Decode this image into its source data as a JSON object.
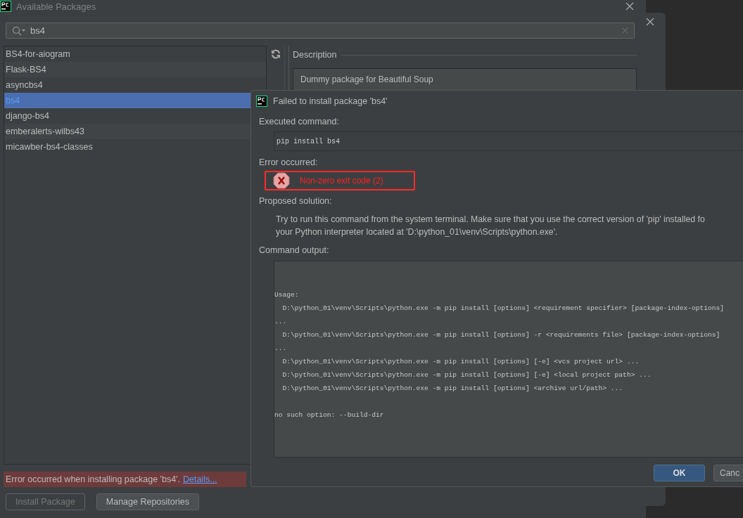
{
  "main_dialog": {
    "title": "Available Packages",
    "search": {
      "value": "bs4"
    },
    "packages": [
      {
        "name": "BS4-for-aiogram",
        "selected": false
      },
      {
        "name": "Flask-BS4",
        "selected": false
      },
      {
        "name": "asyncbs4",
        "selected": false
      },
      {
        "name": "bs4",
        "selected": true
      },
      {
        "name": "django-bs4",
        "selected": false
      },
      {
        "name": "emberalerts-wilbs43",
        "selected": false
      },
      {
        "name": "micawber-bs4-classes",
        "selected": false
      }
    ],
    "description_heading": "Description",
    "description": "Dummy package for Beautiful Soup",
    "error_banner": {
      "text": "Error occurred when installing package 'bs4'.",
      "link": "Details..."
    },
    "buttons": [
      {
        "label": "Install Package",
        "disabled": true
      },
      {
        "label": "Manage Repositories",
        "disabled": false
      }
    ]
  },
  "error_dialog": {
    "title": "Failed to install package 'bs4'",
    "executed_label": "Executed command:",
    "command": "pip install bs4",
    "error_label": "Error occurred:",
    "error_message": "Non-zero exit code (2)",
    "solution_label": "Proposed solution:",
    "solution_lines": [
      "Try to run this command from the system terminal. Make sure that you use the correct version of 'pip' installed fo",
      "your Python interpreter located at 'D:\\python_01\\venv\\Scripts\\python.exe'."
    ],
    "output_label": "Command output:",
    "output_lines": [
      {
        "text": "Usage:"
      },
      {
        "text": "  D:\\python_01\\venv\\Scripts\\python.exe -m pip install [options] <requirement specifier> [package-index-options]"
      },
      {
        "text": "..."
      },
      {
        "text": "  D:\\python_01\\venv\\Scripts\\python.exe -m pip install [options] -r <requirements file> [package-index-options]"
      },
      {
        "text": "..."
      },
      {
        "text": "  D:\\python_01\\venv\\Scripts\\python.exe -m pip install [options] [-e] <vcs project url> ..."
      },
      {
        "text": "  D:\\python_01\\venv\\Scripts\\python.exe -m pip install [options] [-e] <local project path> ..."
      },
      {
        "text": "  D:\\python_01\\venv\\Scripts\\python.exe -m pip install [options] <archive url/path> ..."
      },
      {
        "text": "no such option: --build-dir",
        "gap_before": true
      }
    ],
    "buttons": [
      {
        "label": "OK",
        "default": true
      },
      {
        "label": "Canc",
        "default": false
      }
    ]
  }
}
